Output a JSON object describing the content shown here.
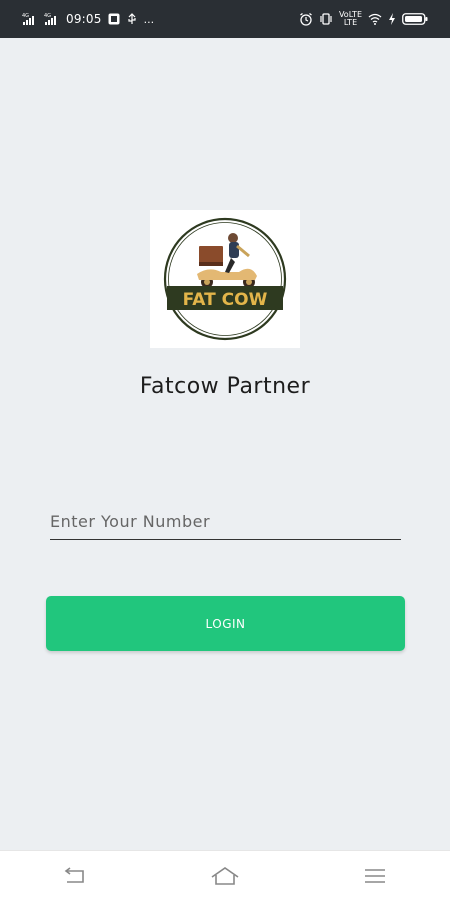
{
  "status_bar": {
    "signal1_label": "4G",
    "signal2_label": "4G",
    "time": "09:05",
    "volte_top": "VoLTE",
    "volte_bottom": "LTE",
    "more_icons": "...",
    "battery_color": "#ffffff"
  },
  "main": {
    "background": "#eceff2",
    "logo_text": "FAT COW",
    "app_title": "Fatcow Partner",
    "phone_placeholder": "Enter Your Number",
    "phone_value": "",
    "login_label": "LOGIN",
    "accent": "#21c67d"
  },
  "nav_bar": {
    "icons": [
      "back-icon",
      "home-icon",
      "menu-icon"
    ]
  }
}
